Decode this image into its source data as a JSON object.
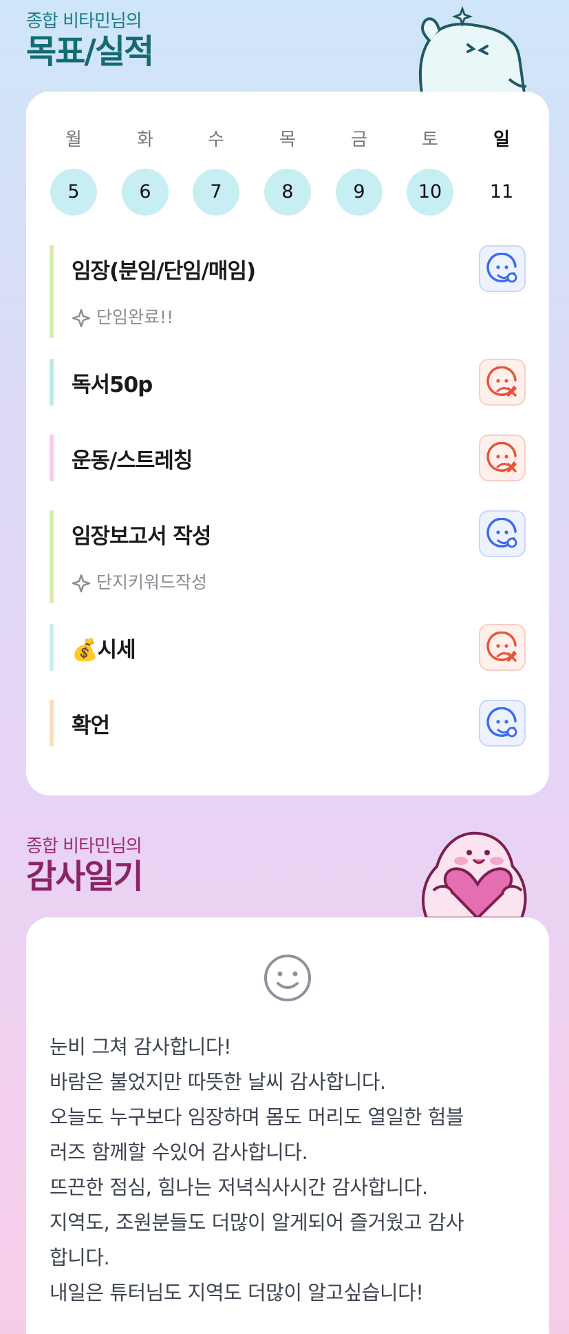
{
  "goals_section": {
    "subtitle": "종합 비타민님의",
    "title": "목표/실적"
  },
  "week": [
    {
      "day": "월",
      "date": "5",
      "completed": true
    },
    {
      "day": "화",
      "date": "6",
      "completed": true
    },
    {
      "day": "수",
      "date": "7",
      "completed": true
    },
    {
      "day": "목",
      "date": "8",
      "completed": true
    },
    {
      "day": "금",
      "date": "9",
      "completed": true
    },
    {
      "day": "토",
      "date": "10",
      "completed": true
    },
    {
      "day": "일",
      "date": "11",
      "completed": false
    }
  ],
  "goals": [
    {
      "title": "임장(분임/단임/매임)",
      "note": "단임완료!!",
      "status": "done",
      "status_icon": "smile-face-icon",
      "color": "#d8ecab"
    },
    {
      "title": "독서50p",
      "note": "",
      "status": "missed",
      "status_icon": "sad-face-icon",
      "color": "#b8ece4"
    },
    {
      "title": "운동/스트레칭",
      "note": "",
      "status": "missed",
      "status_icon": "sad-face-icon",
      "color": "#f8cdea"
    },
    {
      "title": "임장보고서 작성",
      "note": "단지키워드작성",
      "status": "done",
      "status_icon": "smile-face-icon",
      "color": "#d8ecab"
    },
    {
      "title": "💰시세",
      "note": "",
      "status": "missed",
      "status_icon": "sad-face-icon",
      "color": "#c4eef4"
    },
    {
      "title": "확언",
      "note": "",
      "status": "done",
      "status_icon": "smile-face-icon",
      "color": "#fcdcbb"
    }
  ],
  "gratitude_section": {
    "subtitle": "종합 비타민님의",
    "title": "감사일기",
    "mood_icon": "smiley-face-icon",
    "lines": [
      "눈비 그쳐 감사합니다!",
      "바람은 불었지만 따뜻한 날씨 감사합니다.",
      "오늘도 누구보다 임장하며 몸도 머리도 열일한 험블",
      "러즈 함께할 수있어 감사합니다.",
      "뜨끈한 점심, 힘나는 저녁식사시간 감사합니다.",
      "지역도, 조원분들도 더많이 알게되어 즐거웠고 감사",
      "합니다.",
      "내일은 튜터님도 지역도 더많이 알고싶습니다!"
    ]
  },
  "colors": {
    "completed_day": "#c7eef2",
    "done_icon": "#3b6bf0",
    "missed_icon": "#e8533a"
  }
}
